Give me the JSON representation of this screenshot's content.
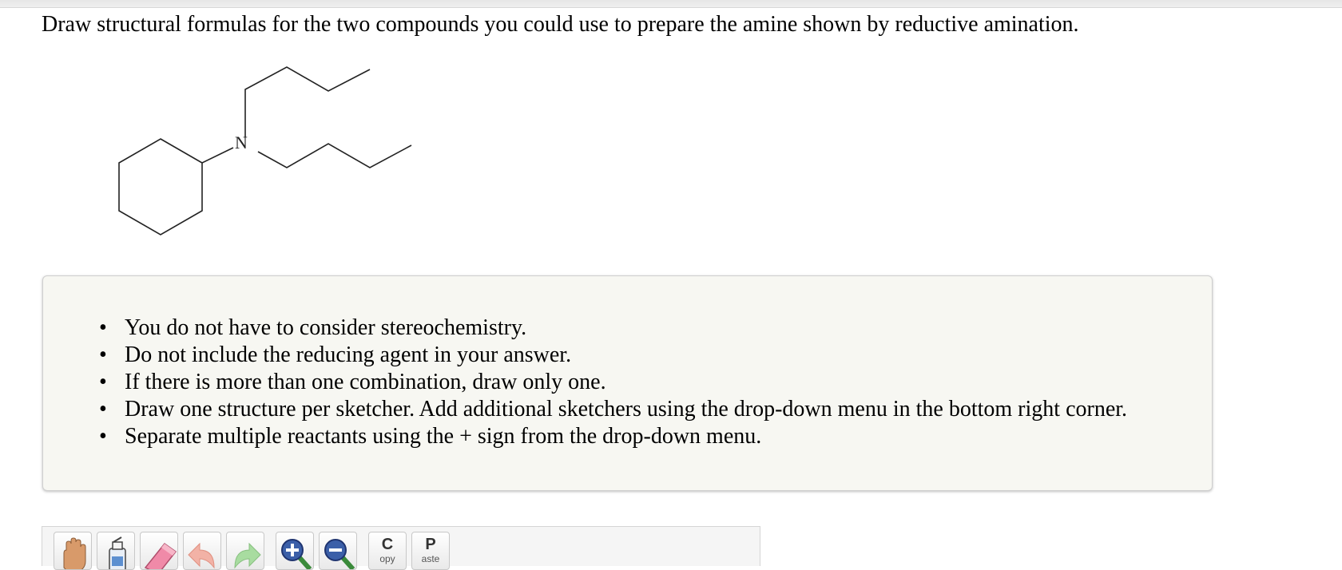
{
  "question": {
    "text": "Draw structural formulas for the two compounds you could use to prepare the amine shown by reductive amination."
  },
  "molecule": {
    "nitrogen_label": "N",
    "description_icon": "n-butyl-n-cyclohexylbutylamine-structure"
  },
  "hints": [
    "You do not have to consider stereochemistry.",
    "Do not include the reducing agent in your answer.",
    "If there is more than one combination, draw only one.",
    "Draw one structure per sketcher. Add additional sketchers using the drop-down menu in the bottom right corner.",
    "Separate multiple reactants using the + sign from the drop-down menu."
  ],
  "toolbar": {
    "copy_cap": "C",
    "copy_sub": "opy",
    "paste_cap": "P",
    "paste_sub": "aste",
    "icons": [
      "hand-icon",
      "eraser-bottle-icon",
      "eraser-icon",
      "undo-icon",
      "redo-icon",
      "zoom-in-icon",
      "zoom-out-icon"
    ]
  }
}
